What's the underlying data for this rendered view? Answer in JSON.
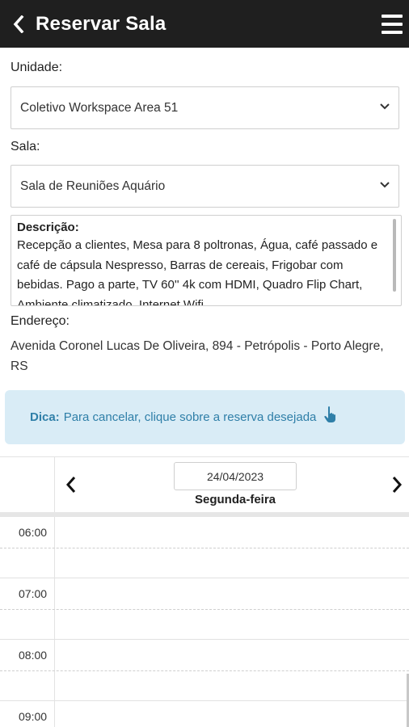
{
  "header": {
    "title": "Reservar Sala"
  },
  "form": {
    "unidade_label": "Unidade:",
    "unidade_value": "Coletivo Workspace Area 51",
    "sala_label": "Sala:",
    "sala_value": "Sala de Reuniões Aquário",
    "descricao_title": "Descrição:",
    "descricao_text": "Recepção a clientes, Mesa para 8 poltronas, Água, café passado e café de cápsula Nespresso, Barras de cereais, Frigobar com bebidas. Pago a parte, TV 60'' 4k com HDMI, Quadro Flip Chart, Ambiente climatizado, Internet Wifi",
    "endereco_label": "Endereço:",
    "endereco_value": "Avenida Coronel Lucas De Oliveira, 894 - Petrópolis - Porto Alegre, RS"
  },
  "tip": {
    "bold": "Dica:",
    "text": "Para cancelar, clique sobre a reserva desejada"
  },
  "calendar": {
    "date": "24/04/2023",
    "weekday": "Segunda-feira",
    "times": [
      "06:00",
      "07:00",
      "08:00",
      "09:00"
    ]
  },
  "icons": {
    "back": "chevron-left-icon",
    "menu": "hamburger-menu-icon",
    "hand": "pointing-hand-icon"
  },
  "colors": {
    "appbar": "#1f1f1f",
    "tip_bg": "#d9ecf6",
    "tip_text": "#2f7fa8"
  }
}
